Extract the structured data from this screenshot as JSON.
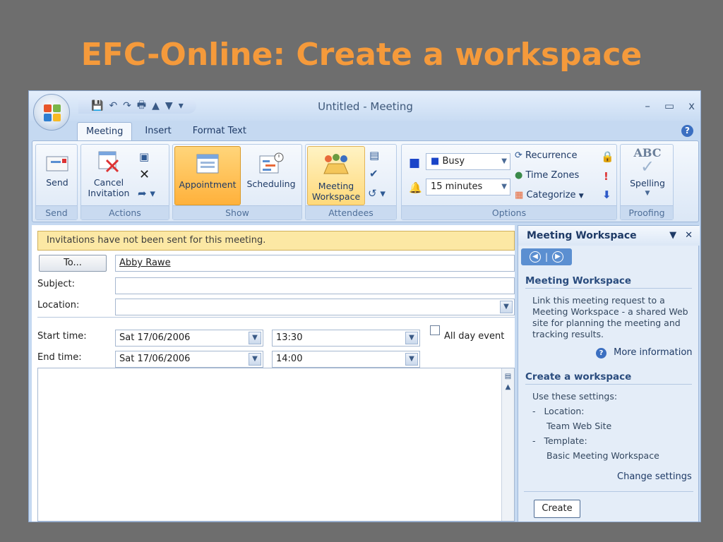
{
  "slide": {
    "title": "EFC-Online: Create a workspace"
  },
  "window": {
    "title": "Untitled - Meeting",
    "controls": {
      "minimize": "–",
      "maximize": "▭",
      "close": "x"
    }
  },
  "tabs": [
    {
      "label": "Meeting",
      "active": true
    },
    {
      "label": "Insert",
      "active": false
    },
    {
      "label": "Format Text",
      "active": false
    }
  ],
  "ribbon": {
    "send": {
      "button": "Send",
      "group": "Send"
    },
    "actions": {
      "cancel": "Cancel",
      "invitation": "Invitation",
      "group": "Actions"
    },
    "show": {
      "appointment": "Appointment",
      "scheduling": "Scheduling",
      "group": "Show"
    },
    "attendees": {
      "meeting": "Meeting",
      "workspace": "Workspace",
      "group": "Attendees"
    },
    "options": {
      "show_as": "Busy",
      "reminder": "15 minutes",
      "recurrence": "Recurrence",
      "time_zones": "Time Zones",
      "categorize": "Categorize",
      "group": "Options"
    },
    "proofing": {
      "abc": "ABC",
      "spelling": "Spelling",
      "group": "Proofing"
    }
  },
  "form": {
    "info": "Invitations have not been sent for this meeting.",
    "to_button": "To...",
    "to_value": "Abby Rawe",
    "subject_label": "Subject:",
    "subject_value": "",
    "location_label": "Location:",
    "location_value": "",
    "start_label": "Start time:",
    "start_date": "Sat 17/06/2006",
    "start_time": "13:30",
    "all_day": "All day event",
    "end_label": "End time:",
    "end_date": "Sat 17/06/2006",
    "end_time": "14:00"
  },
  "pane": {
    "title": "Meeting Workspace",
    "section1_title": "Meeting Workspace",
    "section1_text": "Link this meeting request to a Meeting Workspace - a shared Web site for planning the meeting and tracking results.",
    "more_info": "More information",
    "section2_title": "Create a workspace",
    "settings_intro": "Use these settings:",
    "location_label": "Location:",
    "location_value": "Team Web Site",
    "template_label": "Template:",
    "template_value": "Basic Meeting Workspace",
    "change_settings": "Change settings",
    "create_button": "Create"
  }
}
